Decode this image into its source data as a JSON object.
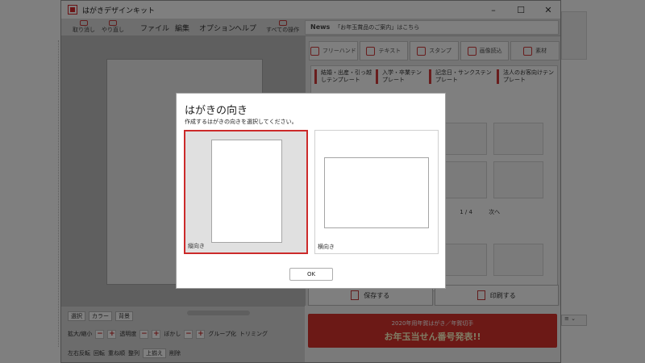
{
  "window": {
    "title": "はがきデザインキット",
    "controls": {
      "minimize": "–",
      "maximize": "☐",
      "close": "✕"
    }
  },
  "toolbar": {
    "undo_label": "取り消し",
    "redo_label": "やり直し",
    "menus": [
      "ファイル",
      "編集",
      "オプション",
      "ヘルプ"
    ],
    "all_actions_label": "すべての操作",
    "news_tag": "News",
    "news_text": "「お年玉賞品のご案内」はこちら"
  },
  "panel": {
    "tabs": [
      "フリーハンド",
      "テキスト",
      "スタンプ",
      "画像読込",
      "素材"
    ],
    "categories": [
      "結婚・出産・引っ越しテンプレート",
      "入学・卒業テンプレート",
      "記念日・サンクステンプレート",
      "法人のお客向けテンプレート"
    ],
    "pager": {
      "prev": "前へ",
      "page": "1 / 4",
      "next": "次へ"
    }
  },
  "actions": {
    "save": "保存する",
    "print": "印刷する"
  },
  "banner": {
    "line1": "2020年用年賀はがき／年賀切手",
    "line2": "お年玉当せん番号発表!!"
  },
  "bottom_tools": {
    "select": "選択",
    "color": "カラー",
    "background": "背景",
    "scale": "拡大/縮小",
    "opacity": "透明度",
    "blur": "ぼかし",
    "group": "グループ化",
    "trimming": "トリミング",
    "flip": "左右反転",
    "rotate": "回転",
    "order": "重ね順",
    "align": "整列",
    "align_top": "上揃え",
    "delete": "削除"
  },
  "dialog": {
    "title": "はがきの向き",
    "subtitle": "作成するはがきの向きを選択してください。",
    "options": [
      {
        "label": "縦向き",
        "selected": true
      },
      {
        "label": "横向き",
        "selected": false
      }
    ],
    "ok_label": "OK",
    "selected_border_color": "#cc2a2a"
  },
  "side": {
    "mini_label": "≡ ⌄"
  }
}
